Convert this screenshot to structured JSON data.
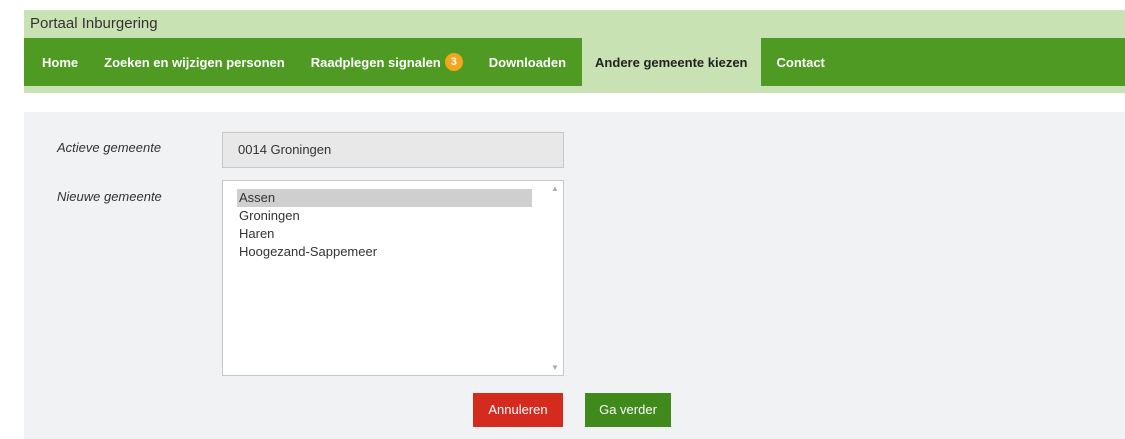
{
  "header": {
    "title": "Portaal Inburgering"
  },
  "nav": {
    "home": "Home",
    "search": "Zoeken en wijzigen personen",
    "signals": "Raadplegen signalen",
    "signals_badge": "3",
    "downloads": "Downloaden",
    "change_municipality": "Andere gemeente kiezen",
    "contact": "Contact"
  },
  "form": {
    "active_label": "Actieve gemeente",
    "active_value": "0014 Groningen",
    "new_label": "Nieuwe gemeente",
    "options": [
      "Assen",
      "Groningen",
      "Haren",
      "Hoogezand-Sappemeer"
    ],
    "selected": "Assen",
    "cancel_label": "Annuleren",
    "next_label": "Ga verder"
  },
  "colors": {
    "nav_green": "#4f9a22",
    "light_green": "#c9e2b4",
    "cancel_red": "#d52a1e",
    "next_green": "#3f8a1a",
    "badge_orange": "#f4a51c"
  }
}
